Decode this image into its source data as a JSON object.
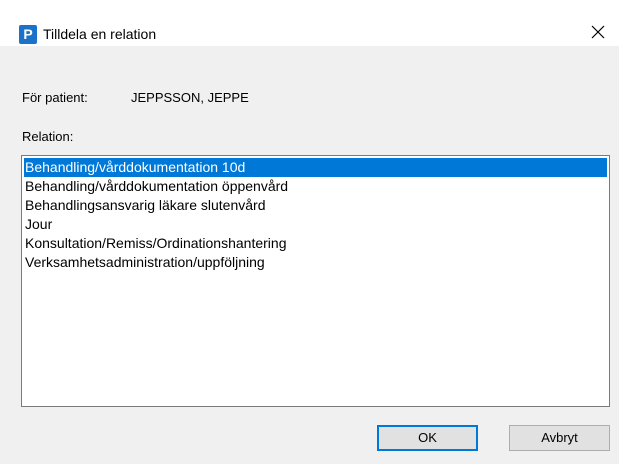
{
  "window": {
    "title": "Tilldela en relation",
    "icon_letter": "P",
    "close_glyph": "✕"
  },
  "patient": {
    "label": "För patient:",
    "name": "JEPPSSON, JEPPE"
  },
  "relation": {
    "label": "Relation:",
    "items": [
      "Behandling/vårddokumentation 10d",
      "Behandling/vårddokumentation öppenvård",
      "Behandlingsansvarig läkare slutenvård",
      "Jour",
      "Konsultation/Remiss/Ordinationshantering",
      "Verksamhetsadministration/uppföljning"
    ],
    "selected_index": 0
  },
  "buttons": {
    "ok": "OK",
    "cancel": "Avbryt"
  },
  "colors": {
    "selection": "#0078d7",
    "icon": "#1a73c8"
  }
}
